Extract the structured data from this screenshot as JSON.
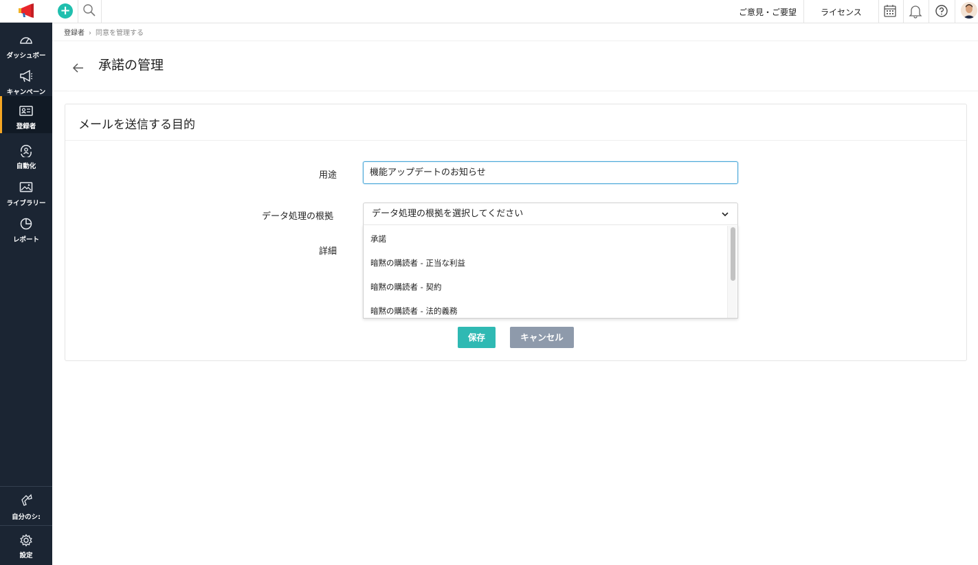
{
  "sidebar": {
    "logo": "campaigns-logo",
    "items": [
      {
        "label": "ダッシュボー",
        "icon": "dashboard-icon"
      },
      {
        "label": "キャンペーン",
        "icon": "megaphone-icon"
      },
      {
        "label": "登録者",
        "icon": "contact-card-icon",
        "active": true
      },
      {
        "label": "自動化",
        "icon": "automation-icon"
      },
      {
        "label": "ライブラリー",
        "icon": "image-library-icon"
      },
      {
        "label": "レポート",
        "icon": "pie-chart-icon"
      }
    ],
    "bottom": [
      {
        "label": "自分のシ:",
        "icon": "share-icon"
      },
      {
        "label": "設定",
        "icon": "gear-icon"
      }
    ],
    "accent_color": "#f5a623"
  },
  "topbar": {
    "feedback": "ご意見・ご要望",
    "license": "ライセンス",
    "icons": [
      "add-icon",
      "search-icon",
      "calendar-icon",
      "bell-icon",
      "help-icon",
      "avatar"
    ]
  },
  "breadcrumb": {
    "parent": "登録者",
    "current": "同意を管理する"
  },
  "page": {
    "title": "承諾の管理"
  },
  "card": {
    "title": "メールを送信する目的",
    "fields": {
      "purpose_label": "用途",
      "purpose_value": "機能アップデートのお知らせ",
      "basis_label": "データ処理の根拠",
      "basis_placeholder": "データ処理の根拠を選択してください",
      "details_label": "詳細"
    },
    "basis_options": [
      "承諾",
      "暗黙の購読者 - 正当な利益",
      "暗黙の購読者 - 契約",
      "暗黙の購読者 - 法的義務"
    ],
    "buttons": {
      "save": "保存",
      "cancel": "キャンセル"
    }
  },
  "colors": {
    "sidebar_bg": "#1b2533",
    "primary_teal": "#2fb9b3",
    "cancel_gray": "#8e9aab",
    "input_focus": "#4aa7d8"
  }
}
